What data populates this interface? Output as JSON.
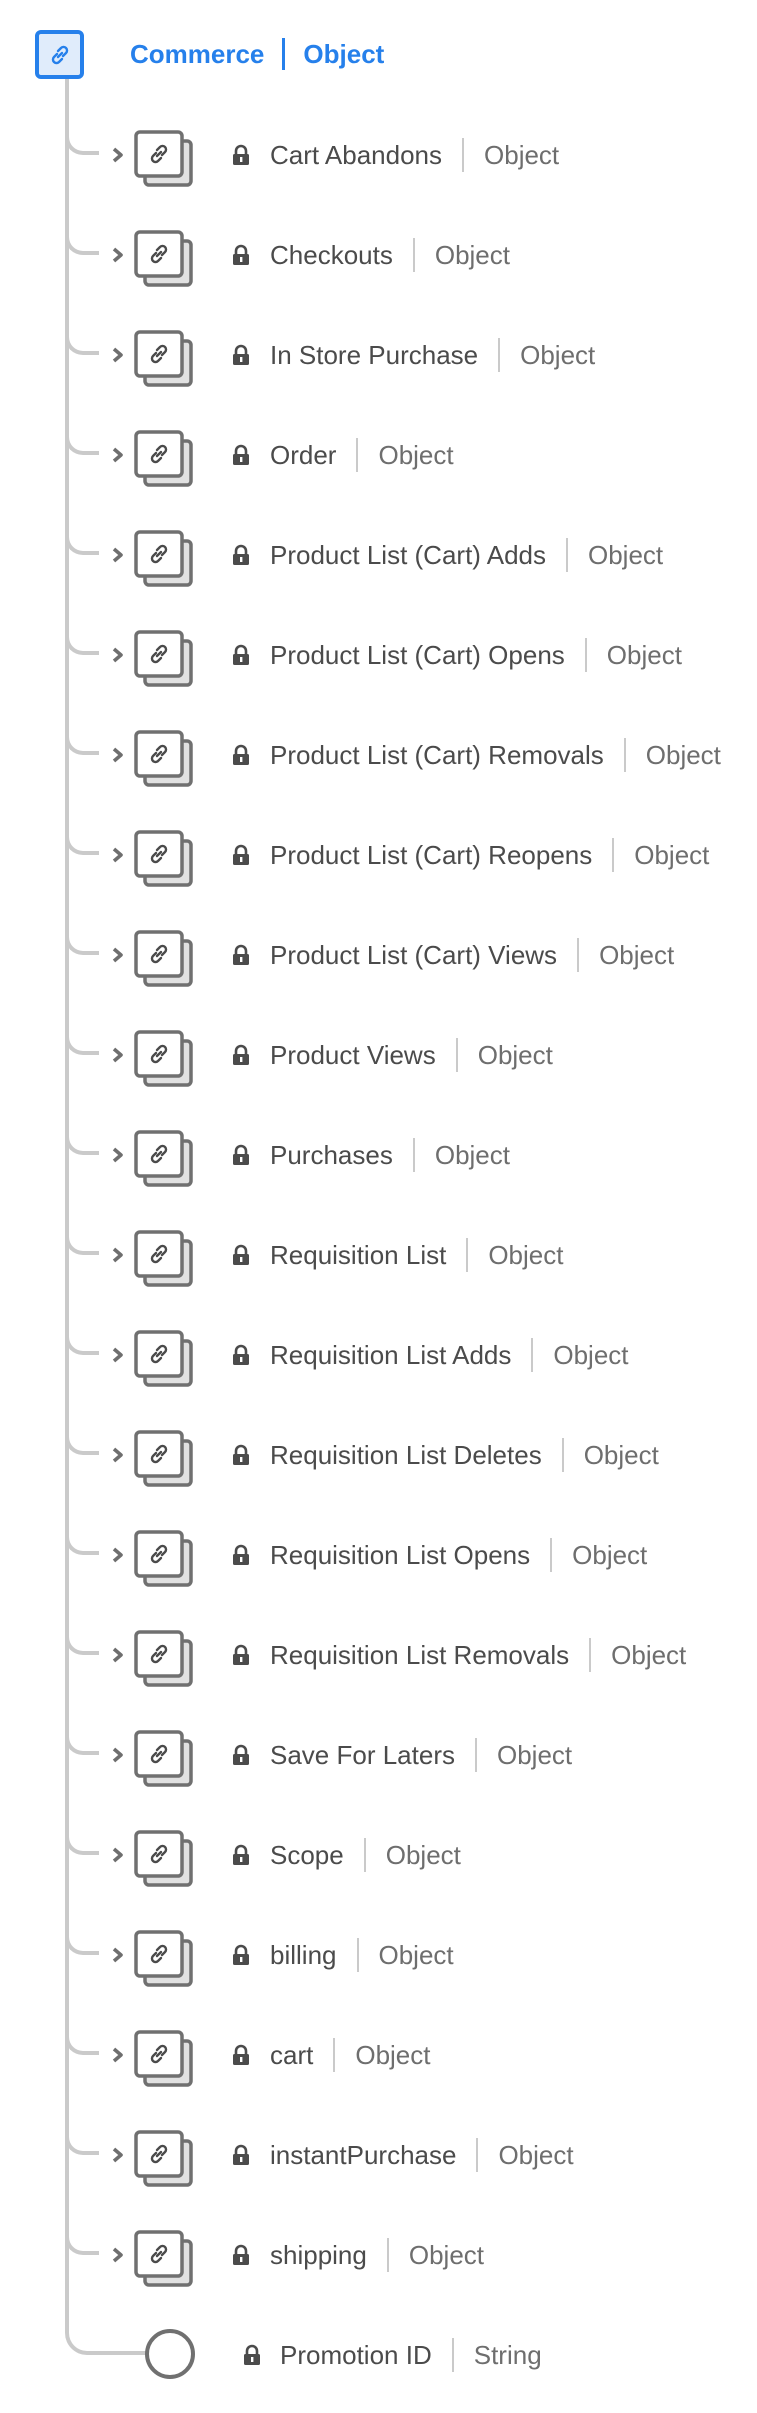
{
  "root": {
    "name": "Commerce",
    "type": "Object",
    "icon": "link-icon",
    "accent": "#2680eb"
  },
  "children": [
    {
      "name": "Cart Abandons",
      "type": "Object"
    },
    {
      "name": "Checkouts",
      "type": "Object"
    },
    {
      "name": "In Store Purchase",
      "type": "Object"
    },
    {
      "name": "Order",
      "type": "Object"
    },
    {
      "name": "Product List (Cart) Adds",
      "type": "Object"
    },
    {
      "name": "Product List (Cart) Opens",
      "type": "Object"
    },
    {
      "name": "Product List (Cart) Removals",
      "type": "Object"
    },
    {
      "name": "Product List (Cart) Reopens",
      "type": "Object"
    },
    {
      "name": "Product List (Cart) Views",
      "type": "Object"
    },
    {
      "name": "Product Views",
      "type": "Object"
    },
    {
      "name": "Purchases",
      "type": "Object"
    },
    {
      "name": "Requisition List",
      "type": "Object"
    },
    {
      "name": "Requisition List Adds",
      "type": "Object"
    },
    {
      "name": "Requisition List Deletes",
      "type": "Object"
    },
    {
      "name": "Requisition List Opens",
      "type": "Object"
    },
    {
      "name": "Requisition List Removals",
      "type": "Object"
    },
    {
      "name": "Save For Laters",
      "type": "Object"
    },
    {
      "name": "Scope",
      "type": "Object"
    },
    {
      "name": "billing",
      "type": "Object"
    },
    {
      "name": "cart",
      "type": "Object"
    },
    {
      "name": "instantPurchase",
      "type": "Object"
    },
    {
      "name": "shipping",
      "type": "Object"
    }
  ],
  "leaf": {
    "name": "Promotion ID",
    "type": "String"
  }
}
